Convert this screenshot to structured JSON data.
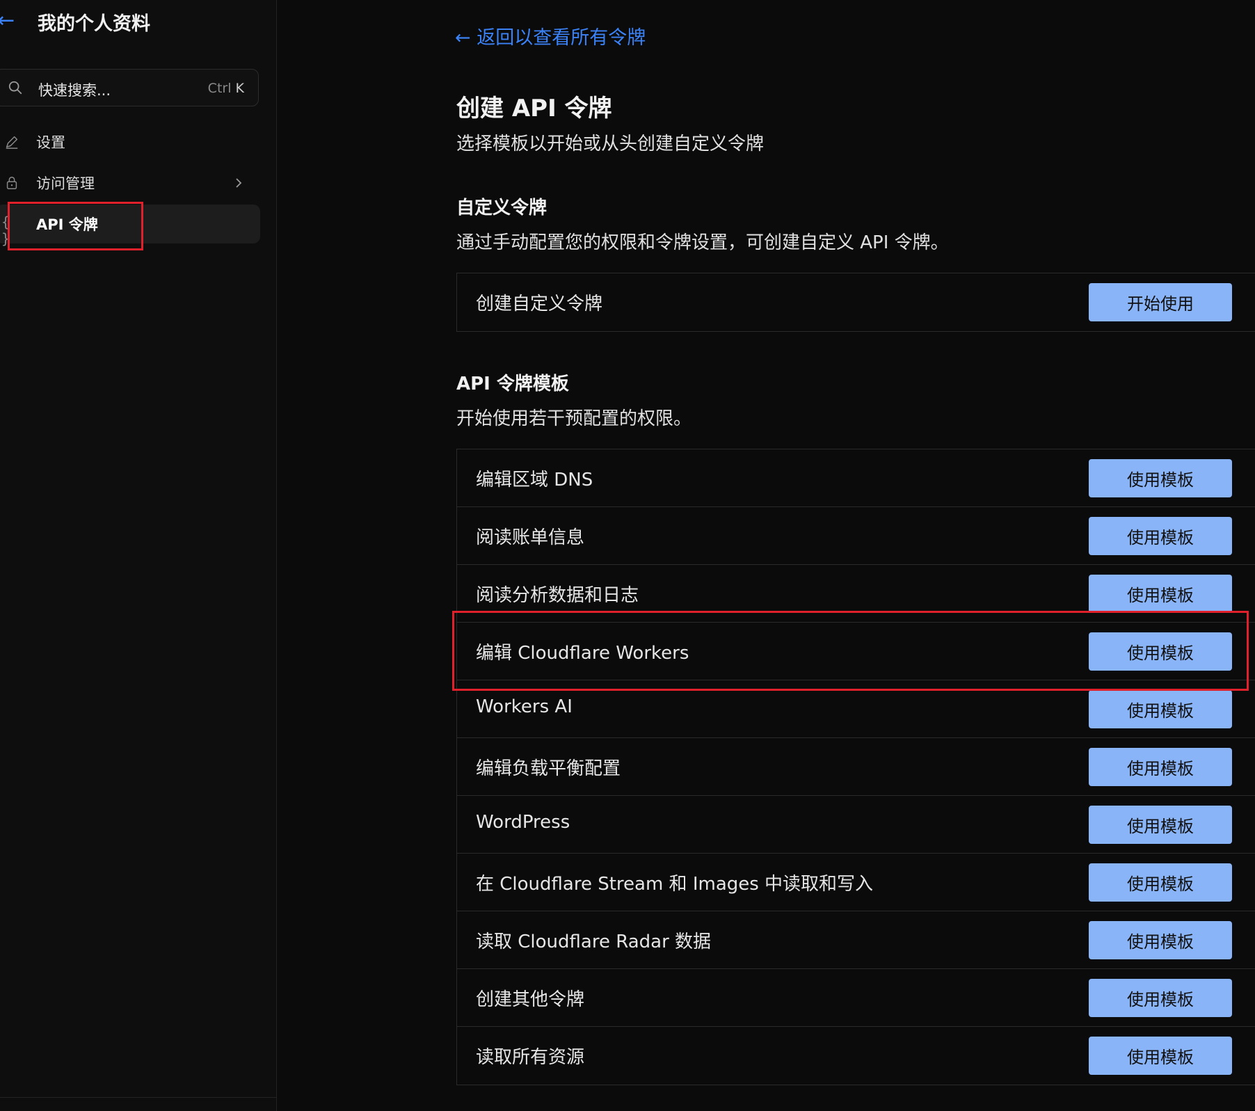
{
  "sidebar": {
    "title": "我的个人资料",
    "search": {
      "placeholder": "快速搜索...",
      "shortcut_mod": "Ctrl",
      "shortcut_key": "K"
    },
    "items": [
      {
        "label": "设置",
        "icon": "pencil-icon"
      },
      {
        "label": "访问管理",
        "icon": "lock-icon"
      },
      {
        "label": "API 令牌",
        "icon": "braces-icon",
        "active": true
      }
    ],
    "braces_glyph": "{ }"
  },
  "main": {
    "back_link": "← 返回以查看所有令牌",
    "title": "创建 API 令牌",
    "subtitle": "选择模板以开始或从头创建自定义令牌",
    "custom": {
      "title": "自定义令牌",
      "description": "通过手动配置您的权限和令牌设置，可创建自定义 API 令牌。",
      "row_label": "创建自定义令牌",
      "button_label": "开始使用"
    },
    "templates": {
      "title": "API 令牌模板",
      "description": "开始使用若干预配置的权限。",
      "button_label": "使用模板",
      "rows": [
        "编辑区域 DNS",
        "阅读账单信息",
        "阅读分析数据和日志",
        "编辑 Cloudflare Workers",
        "Workers AI",
        "编辑负载平衡配置",
        "WordPress",
        "在 Cloudflare Stream 和 Images 中读取和写入",
        "读取 Cloudflare Radar 数据",
        "创建其他令牌",
        "读取所有资源"
      ]
    }
  },
  "colors": {
    "accent": "#3b82f6",
    "button": "#8ab4f8",
    "highlight": "#e0212b",
    "background": "#0b0b0b"
  }
}
